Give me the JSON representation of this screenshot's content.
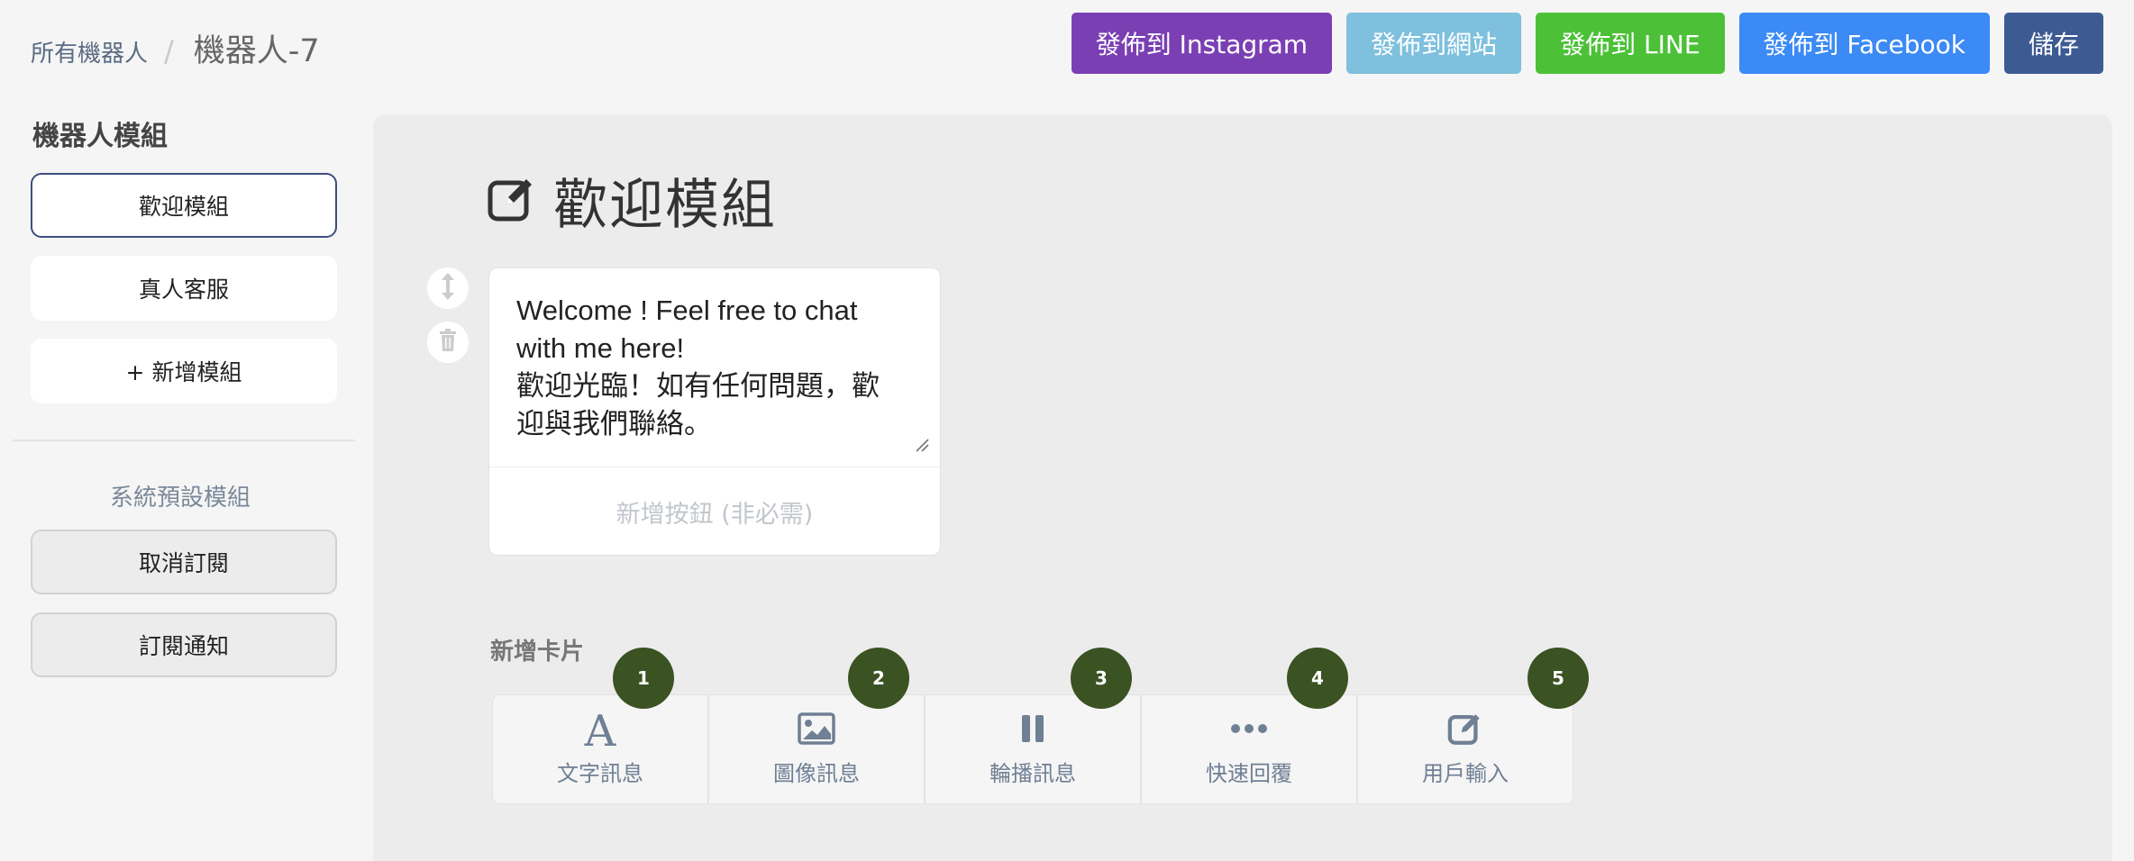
{
  "breadcrumb": {
    "parent": "所有機器人",
    "separator": "/",
    "current": "機器人-7"
  },
  "top_actions": [
    {
      "label": "發佈到 Instagram",
      "color": "#7b3fb4"
    },
    {
      "label": "發佈到網站",
      "color": "#7ec0dd"
    },
    {
      "label": "發佈到 LINE",
      "color": "#4cc138"
    },
    {
      "label": "發佈到 Facebook",
      "color": "#3b8af5"
    },
    {
      "label": "儲存",
      "color": "#3d5a93"
    }
  ],
  "sidebar": {
    "heading": "機器人模組",
    "items": [
      {
        "label": "歡迎模組",
        "active": true
      },
      {
        "label": "真人客服",
        "active": false
      },
      {
        "label": "+ 新增模組",
        "active": false
      }
    ],
    "system_heading": "系統預設模組",
    "system_items": [
      {
        "label": "取消訂閱"
      },
      {
        "label": "訂閱通知"
      }
    ]
  },
  "main": {
    "title": "歡迎模組",
    "title_icon": "edit-icon",
    "card": {
      "text": "Welcome ! Feel free to chat\nwith me here!\n歡迎光臨！如有任何問題，歡\n迎與我們聯絡。",
      "add_button_label": "新增按鈕 (非必需)"
    },
    "add_card_label": "新增卡片",
    "card_types": [
      {
        "label": "文字訊息",
        "icon": "font-icon",
        "badge": "1"
      },
      {
        "label": "圖像訊息",
        "icon": "image-icon",
        "badge": "2"
      },
      {
        "label": "輪播訊息",
        "icon": "carousel-icon",
        "badge": "3"
      },
      {
        "label": "快速回覆",
        "icon": "ellipsis-icon",
        "badge": "4"
      },
      {
        "label": "用戶輸入",
        "icon": "edit-icon",
        "badge": "5"
      }
    ]
  },
  "colors": {
    "badge": "#3b5223",
    "icon_gray": "#6f7f94"
  }
}
